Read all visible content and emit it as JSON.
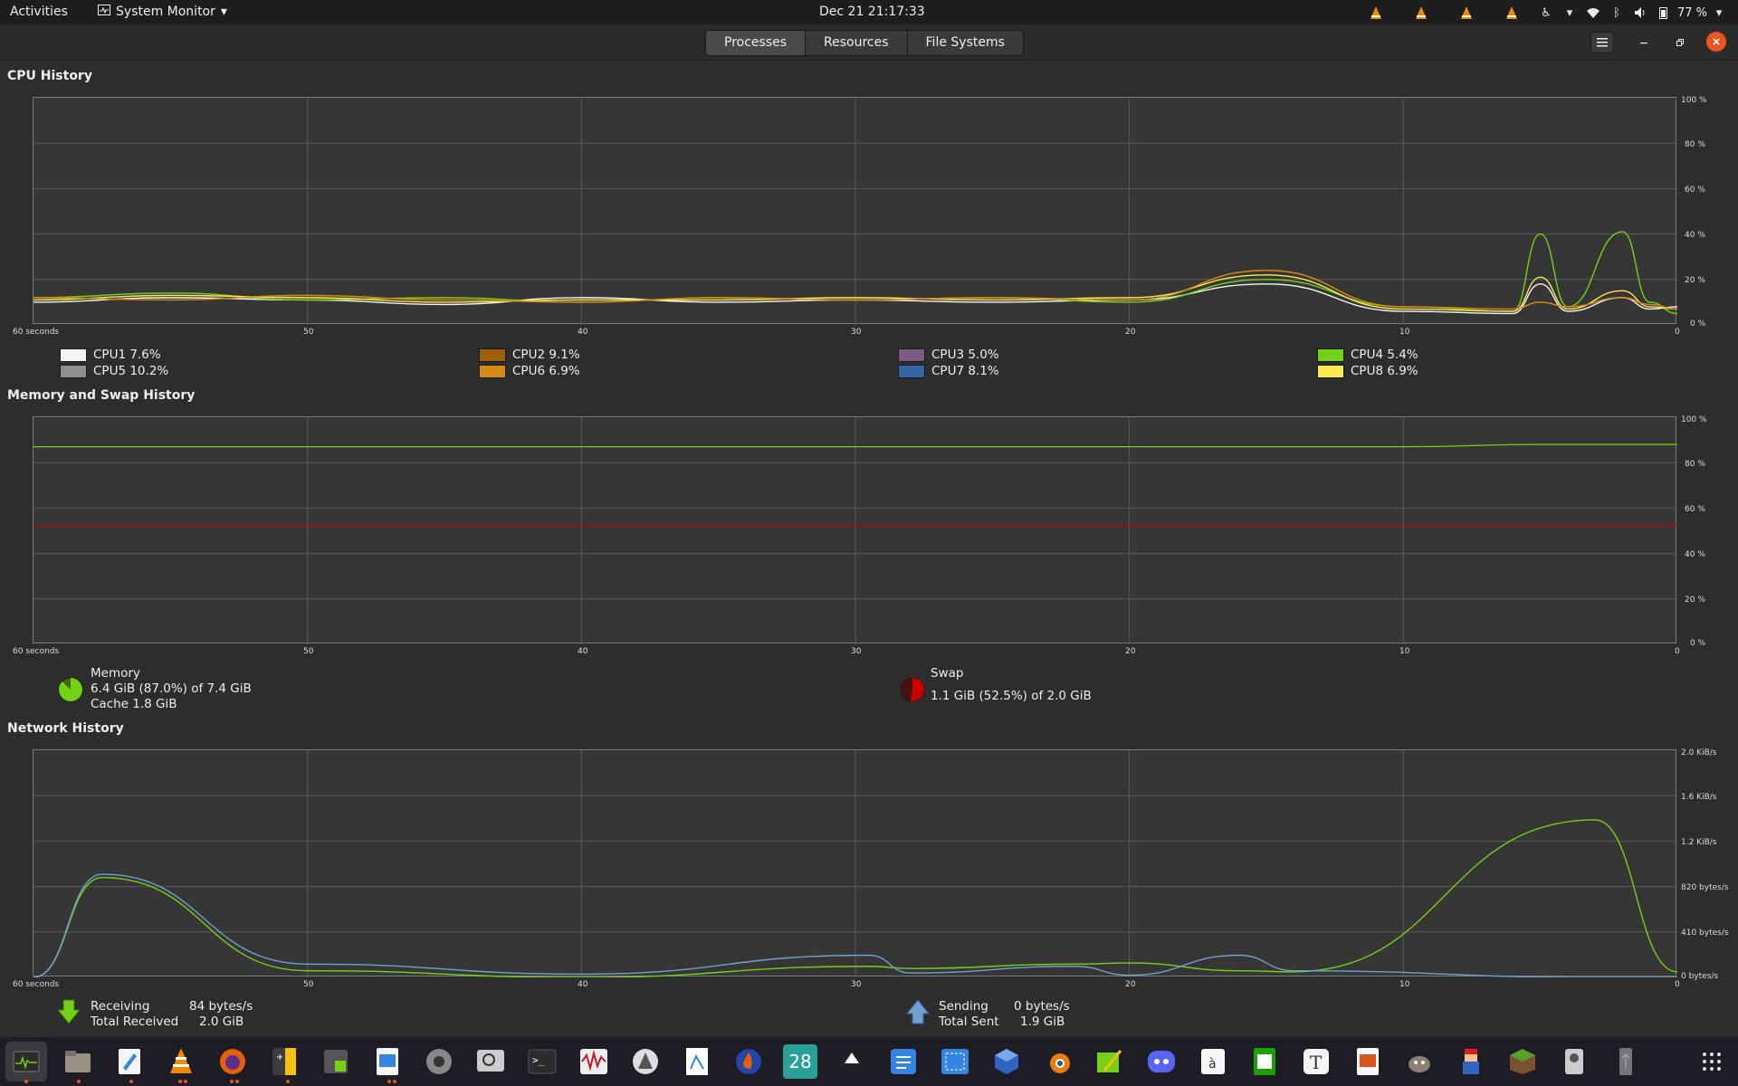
{
  "topbar": {
    "activities": "Activities",
    "app_menu": "System Monitor",
    "clock": "Dec 21  21:17:33",
    "battery": "77 %"
  },
  "tabs": [
    {
      "label": "Processes",
      "active": true
    },
    {
      "label": "Resources",
      "active": false
    },
    {
      "label": "File Systems",
      "active": false
    }
  ],
  "cpu": {
    "title": "CPU History",
    "y_ticks": [
      "100 %",
      "80 %",
      "60 %",
      "40 %",
      "20 %",
      "0 %"
    ],
    "x_ticks": [
      "60 seconds",
      "50",
      "40",
      "30",
      "20",
      "10",
      "0"
    ],
    "legend": [
      {
        "label": "CPU1",
        "value": "7.6%",
        "color": "#f5f5f5"
      },
      {
        "label": "CPU2",
        "value": "9.1%",
        "color": "#a05e08"
      },
      {
        "label": "CPU3",
        "value": "5.0%",
        "color": "#7e5a86"
      },
      {
        "label": "CPU4",
        "value": "5.4%",
        "color": "#73d216"
      },
      {
        "label": "CPU5",
        "value": "10.2%",
        "color": "#8f8f8f"
      },
      {
        "label": "CPU6",
        "value": "6.9%",
        "color": "#d88a17"
      },
      {
        "label": "CPU7",
        "value": "8.1%",
        "color": "#3465a4"
      },
      {
        "label": "CPU8",
        "value": "6.9%",
        "color": "#fce94f"
      }
    ]
  },
  "memory": {
    "title": "Memory and Swap History",
    "y_ticks": [
      "100 %",
      "80 %",
      "60 %",
      "40 %",
      "20 %",
      "0 %"
    ],
    "x_ticks": [
      "60 seconds",
      "50",
      "40",
      "30",
      "20",
      "10",
      "0"
    ],
    "mem_label": "Memory",
    "mem_usage": "6.4 GiB (87.0%) of 7.4 GiB",
    "mem_cache": "Cache 1.8 GiB",
    "swap_label": "Swap",
    "swap_usage": "1.1 GiB (52.5%) of 2.0 GiB",
    "mem_percent": 87.0,
    "swap_percent": 52.5,
    "mem_color": "#73d216",
    "swap_color": "#cc0000"
  },
  "network": {
    "title": "Network History",
    "y_ticks": [
      "2.0 KiB/s",
      "1.6 KiB/s",
      "1.2 KiB/s",
      "820 bytes/s",
      "410 bytes/s",
      "0 bytes/s"
    ],
    "x_ticks": [
      "60 seconds",
      "50",
      "40",
      "30",
      "20",
      "10",
      "0"
    ],
    "receiving_label": "Receiving",
    "receiving_value": "84 bytes/s",
    "total_received_label": "Total Received",
    "total_received_value": "2.0 GiB",
    "sending_label": "Sending",
    "sending_value": "0 bytes/s",
    "total_sent_label": "Total Sent",
    "total_sent_value": "1.9 GiB",
    "recv_color": "#73d216",
    "send_color": "#729fcf"
  },
  "chart_data": [
    {
      "type": "line",
      "title": "CPU History",
      "x_unit": "seconds ago",
      "ylim": [
        0,
        100
      ],
      "x": [
        60,
        55,
        50,
        45,
        40,
        35,
        30,
        25,
        20,
        15,
        10,
        6,
        5,
        4,
        2,
        1,
        0
      ],
      "series": [
        {
          "name": "CPU1",
          "values": [
            10,
            12,
            11,
            9,
            12,
            10,
            11,
            10,
            11,
            18,
            6,
            5,
            18,
            6,
            12,
            7,
            8
          ]
        },
        {
          "name": "CPU4",
          "values": [
            12,
            14,
            11,
            12,
            10,
            12,
            11,
            12,
            10,
            20,
            8,
            6,
            40,
            8,
            41,
            10,
            5
          ]
        },
        {
          "name": "CPU8",
          "values": [
            11,
            13,
            12,
            10,
            11,
            11,
            12,
            11,
            12,
            22,
            7,
            6,
            21,
            7,
            15,
            8,
            7
          ]
        },
        {
          "name": "CPU6",
          "values": [
            12,
            11,
            13,
            11,
            10,
            12,
            11,
            12,
            11,
            24,
            8,
            7,
            10,
            8,
            12,
            9,
            7
          ]
        }
      ]
    },
    {
      "type": "line",
      "title": "Memory and Swap History",
      "ylim": [
        0,
        100
      ],
      "series": [
        {
          "name": "Memory",
          "values": [
            87,
            87,
            87,
            87,
            87,
            87,
            87,
            87,
            87,
            87,
            87,
            88,
            88
          ]
        },
        {
          "name": "Swap",
          "values": [
            52.5,
            52.5,
            52.5,
            52.5,
            52.5,
            52.5,
            52.5,
            52.5,
            52.5,
            52.5,
            52.5,
            52.5,
            52.5
          ]
        }
      ]
    },
    {
      "type": "line",
      "title": "Network History",
      "y_unit": "bytes/s",
      "ylim": [
        0,
        2048
      ],
      "x": [
        60,
        57.5,
        50,
        40,
        29.5,
        28,
        22,
        20,
        16,
        14,
        3,
        0
      ],
      "series": [
        {
          "name": "Receiving",
          "values": [
            0,
            900,
            60,
            0,
            100,
            80,
            120,
            130,
            60,
            50,
            1420,
            50
          ]
        },
        {
          "name": "Sending",
          "values": [
            0,
            930,
            120,
            30,
            200,
            40,
            100,
            20,
            200,
            60,
            0,
            0
          ]
        }
      ]
    }
  ]
}
